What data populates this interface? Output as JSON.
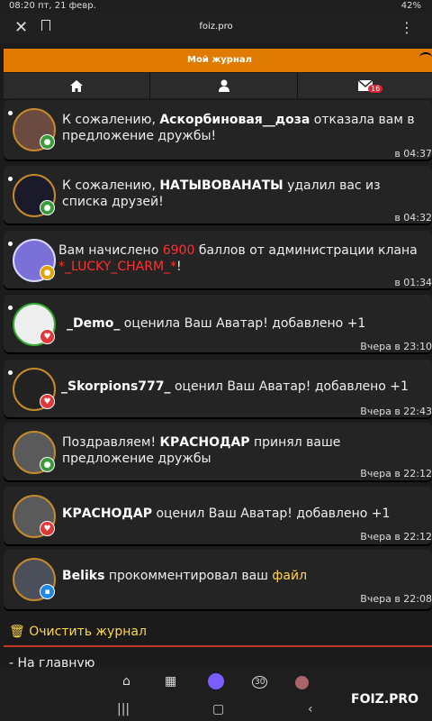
{
  "status_bar": {
    "time_date": "08:20  пт, 21 февр.",
    "battery": "42%"
  },
  "browser": {
    "url": "foiz.pro"
  },
  "header": {
    "title": "Мой журнал"
  },
  "nav": {
    "mail_badge": "16"
  },
  "items": [
    {
      "pre": "К сожалению, ",
      "bold": "Аскорбиновая__доза",
      "post": " отказала вам в предложение дружбы!",
      "time": "в 04:37"
    },
    {
      "pre": "К сожалению, ",
      "bold": "НАТЫВОВАНАТЫ",
      "post": " удалил вас из списка друзей!",
      "time": "в 04:32"
    },
    {
      "pre": "Вам начислено ",
      "red": "6900",
      "mid": " баллов от администрации клана ",
      "red2": "*_LUCKY_CHARM_*",
      "post": "!",
      "time": "в 01:34"
    },
    {
      "bold": "_Demo_",
      "post": " оценила Ваш Аватар! добавлено +1",
      "time": "Вчера в 23:10"
    },
    {
      "bold": "_Skorpions777_",
      "post": " оценил Ваш Аватар! добавлено +1",
      "time": "Вчера в 22:43"
    },
    {
      "pre": "Поздравляем! ",
      "bold": "КРАСНОДАР",
      "post": " принял ваше предложение дружбы",
      "time": "Вчера в 22:12"
    },
    {
      "bold": "КРАСНОДАР",
      "post": " оценил Ваш Аватар! добавлено +1",
      "time": "Вчера в 22:12"
    },
    {
      "bold": "Beliks",
      "post": " прокомментировал ваш ",
      "link": "файл",
      "time": "Вчера в 22:08"
    }
  ],
  "footer": {
    "clear": "Очистить журнал",
    "home": "- На главную"
  },
  "bottom_nav": {
    "badge": "30"
  },
  "watermark": "FOIZ.PRO"
}
